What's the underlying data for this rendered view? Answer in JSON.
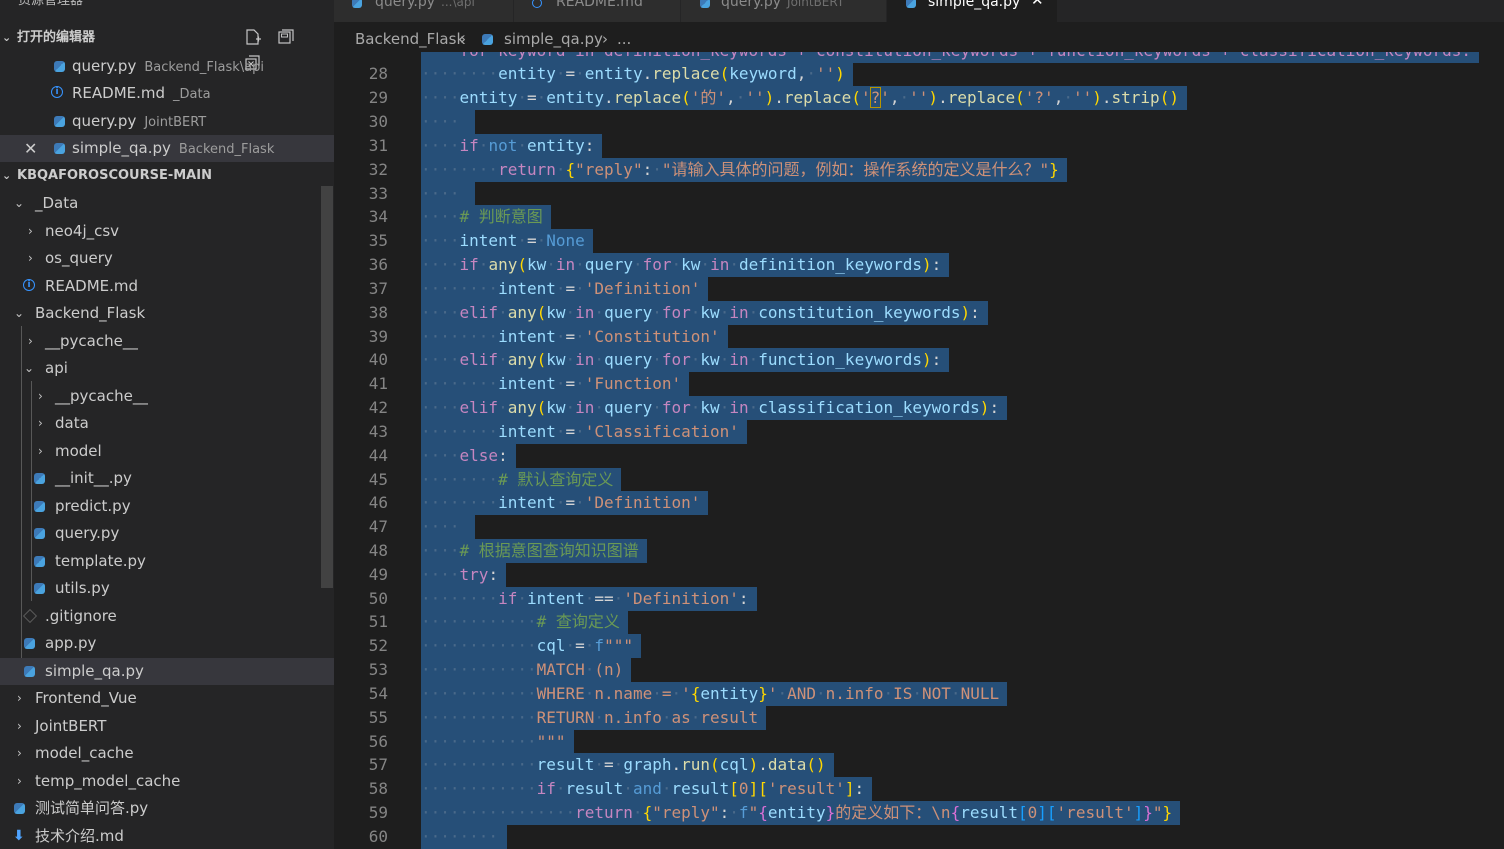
{
  "sidebar": {
    "title": "资源管理器",
    "more": "···",
    "open_editors_label": "打开的编辑器",
    "open_editors": [
      {
        "name": "query.py",
        "desc": "Backend_Flask\\api",
        "icon": "python-icon"
      },
      {
        "name": "README.md",
        "desc": "_Data",
        "icon": "info-icon"
      },
      {
        "name": "query.py",
        "desc": "JointBERT",
        "icon": "python-icon"
      },
      {
        "name": "simple_qa.py",
        "desc": "Backend_Flask",
        "icon": "python-icon"
      }
    ],
    "project_label": "KBQAFOROSCOURSE-MAIN",
    "tree": [
      {
        "label": "_Data",
        "type": "folder-open"
      },
      {
        "label": "neo4j_csv",
        "type": "folder"
      },
      {
        "label": "os_query",
        "type": "folder"
      },
      {
        "label": "README.md",
        "type": "info"
      },
      {
        "label": "Backend_Flask",
        "type": "folder-open"
      },
      {
        "label": "__pycache__",
        "type": "folder"
      },
      {
        "label": "api",
        "type": "folder-open"
      },
      {
        "label": "__pycache__",
        "type": "folder"
      },
      {
        "label": "data",
        "type": "folder"
      },
      {
        "label": "model",
        "type": "folder"
      },
      {
        "label": "__init__.py",
        "type": "python"
      },
      {
        "label": "predict.py",
        "type": "python"
      },
      {
        "label": "query.py",
        "type": "python"
      },
      {
        "label": "template.py",
        "type": "python"
      },
      {
        "label": "utils.py",
        "type": "python"
      },
      {
        "label": ".gitignore",
        "type": "git"
      },
      {
        "label": "app.py",
        "type": "python"
      },
      {
        "label": "simple_qa.py",
        "type": "python"
      },
      {
        "label": "Frontend_Vue",
        "type": "folder"
      },
      {
        "label": "JointBERT",
        "type": "folder"
      },
      {
        "label": "model_cache",
        "type": "folder"
      },
      {
        "label": "temp_model_cache",
        "type": "folder"
      },
      {
        "label": "测试简单问答.py",
        "type": "python"
      },
      {
        "label": "技术介绍.md",
        "type": "markdown"
      }
    ]
  },
  "tabs": [
    {
      "name": "query.py",
      "desc": "...\\api"
    },
    {
      "name": "README.md",
      "desc": ""
    },
    {
      "name": "query.py",
      "desc": "JointBERT"
    },
    {
      "name": "simple_qa.py",
      "desc": "",
      "close": "✕"
    }
  ],
  "breadcrumb": {
    "folder": "Backend_Flask",
    "file": "simple_qa.py",
    "rest": "..."
  },
  "editor": {
    "line_numbers": [
      "28",
      "29",
      "30",
      "31",
      "32",
      "33",
      "34",
      "35",
      "36",
      "37",
      "38",
      "39",
      "40",
      "41",
      "42",
      "43",
      "44",
      "45",
      "46",
      "47",
      "48",
      "49",
      "50",
      "51",
      "52",
      "53",
      "54",
      "55",
      "56",
      "57",
      "58",
      "59",
      "60"
    ],
    "top_partial_line": "for keyword in definition_keywords + constitution_keywords + function_keywords + classification_keywords:"
  },
  "colors": {
    "selection": "#264f78",
    "keyword": "#569cd6",
    "control": "#c586c0",
    "function": "#dcdcaa",
    "variable": "#9cdcfe",
    "string": "#ce9178",
    "comment": "#6a9955"
  }
}
